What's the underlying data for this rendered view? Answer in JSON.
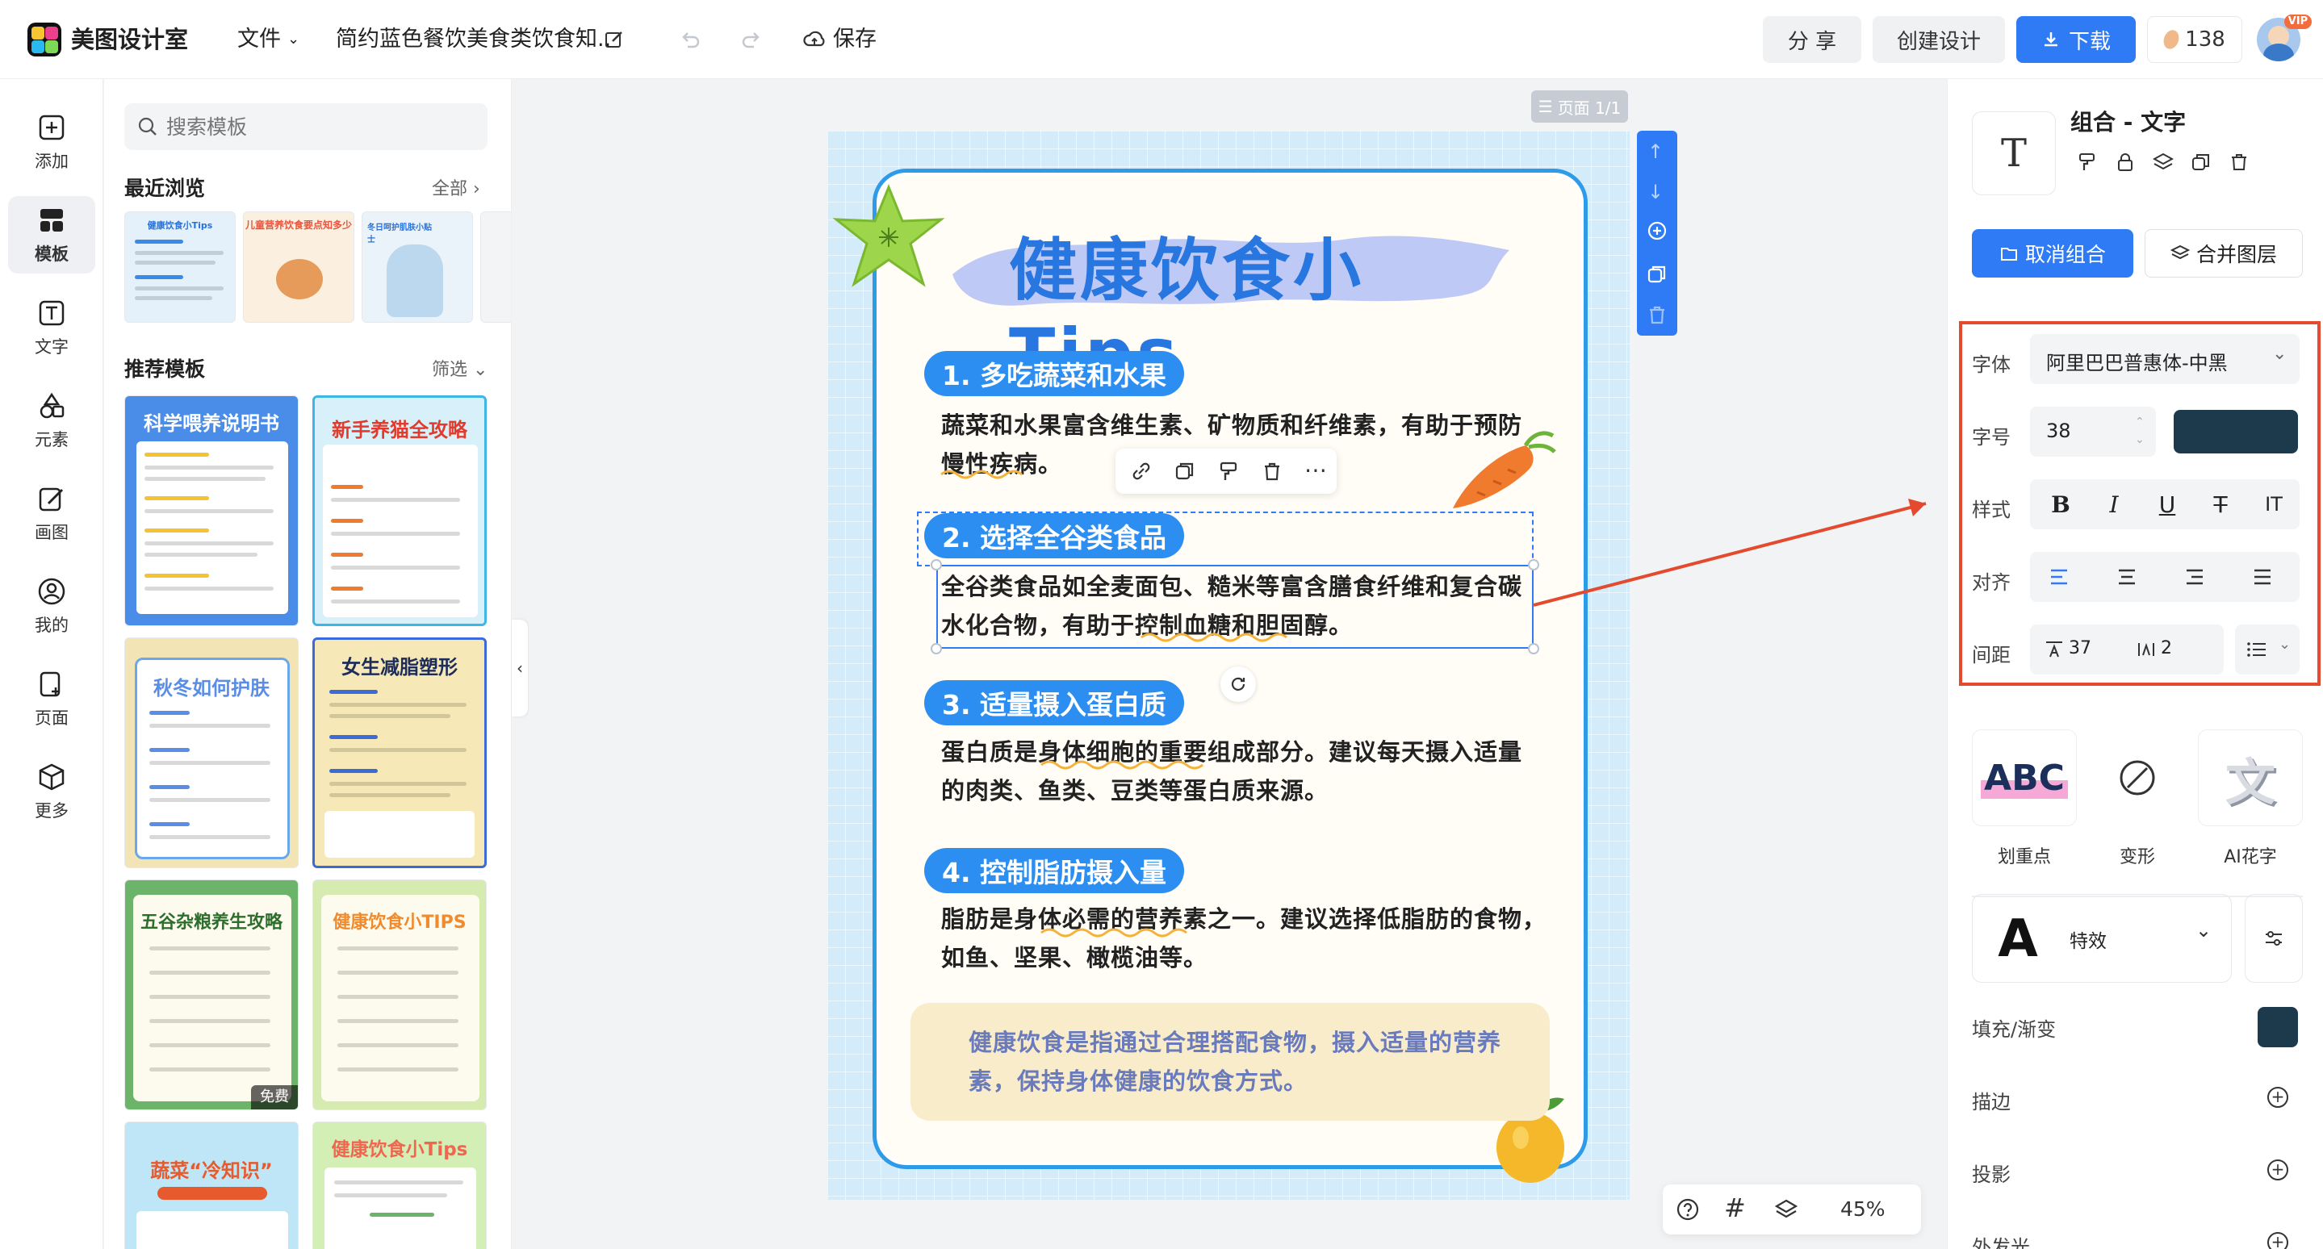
{
  "app": {
    "name": "美图设计室"
  },
  "topbar": {
    "file_menu": "文件",
    "doc_title": "简约蓝色餐饮美食类饮食知...",
    "save": "保存",
    "share": "分 享",
    "create": "创建设计",
    "download": "下载",
    "credits": "138",
    "vip": "VIP"
  },
  "rail": [
    {
      "label": "添加",
      "icon": "plus-square-icon"
    },
    {
      "label": "模板",
      "icon": "template-grid-icon",
      "active": true
    },
    {
      "label": "文字",
      "icon": "text-icon"
    },
    {
      "label": "元素",
      "icon": "shapes-icon"
    },
    {
      "label": "画图",
      "icon": "draw-icon"
    },
    {
      "label": "我的",
      "icon": "user-icon"
    },
    {
      "label": "页面",
      "icon": "page-add-icon"
    },
    {
      "label": "更多",
      "icon": "box-icon"
    }
  ],
  "templates": {
    "search_placeholder": "搜索模板",
    "recent_title": "最近浏览",
    "recent_more": "全部",
    "recommend_title": "推荐模板",
    "recommend_filter": "筛选",
    "cards": [
      {
        "title": "科学喂养说明书",
        "color": "#4a8de8",
        "title_color": "#fff"
      },
      {
        "title": "新手养猫全攻略",
        "color": "#d8f0fa",
        "title_color": "#e03b2d"
      },
      {
        "title": "秋冬如何护肤",
        "color": "#f2e4b4",
        "title_color": "#5a8ee6"
      },
      {
        "title": "女生减脂塑形",
        "color": "#f7e9b7",
        "title_color": "#1e2c5a"
      },
      {
        "title": "五谷杂粮养生攻略",
        "color": "#6db46b",
        "title_color": "#2d6e2c"
      },
      {
        "title": "健康饮食小TIPS",
        "color": "#d6ebb0",
        "title_color": "#f08b2d"
      },
      {
        "title": "蔬菜“冷知识”",
        "color": "#bfe6f7",
        "title_color": "#e65a2d"
      },
      {
        "title": "健康饮食小Tips",
        "color": "#d3efb6",
        "title_color": "#f0664f"
      }
    ],
    "free_badge": "免费",
    "recent_cards": [
      {
        "title": "健康饮食小Tips"
      },
      {
        "title": "儿童营养饮食要点知多少"
      },
      {
        "title": "冬日呵护肌肤小贴士"
      }
    ]
  },
  "canvas": {
    "page_chip": "页面 1/1",
    "zoom": "45%"
  },
  "poster": {
    "title": "健康饮食小Tips",
    "sections": [
      {
        "heading": "1. 多吃蔬菜和水果",
        "body": "蔬菜和水果富含维生素、矿物质和纤维素，有助于预防慢性疾病。"
      },
      {
        "heading": "2. 选择全谷类食品",
        "body": "全谷类食品如全麦面包、糙米等富含膳食纤维和复合碳水化合物，有助于控制血糖和胆固醇。"
      },
      {
        "heading": "3. 适量摄入蛋白质",
        "body": "蛋白质是身体细胞的重要组成部分。建议每天摄入适量的肉类、鱼类、豆类等蛋白质来源。"
      },
      {
        "heading": "4. 控制脂肪摄入量",
        "body": "脂肪是身体必需的营养素之一。建议选择低脂肪的食物，如鱼、坚果、橄榄油等。"
      }
    ],
    "summary": "健康饮食是指通过合理搭配食物，摄入适量的营养素，保持身体健康的饮食方式。"
  },
  "properties": {
    "header_title": "组合 - 文字",
    "ungroup": "取消组合",
    "merge": "合并图层",
    "font_label": "字体",
    "font_value": "阿里巴巴普惠体-中黑",
    "size_label": "字号",
    "size_value": "38",
    "text_color": "#1d3a4d",
    "style_label": "样式",
    "align_label": "对齐",
    "spacing_label": "间距",
    "letter_spacing": "37",
    "line_spacing": "2",
    "effects": [
      {
        "label": "划重点"
      },
      {
        "label": "变形"
      },
      {
        "label": "AI花字"
      }
    ],
    "special_effect": "特效",
    "fill_label": "填充/渐变",
    "fill_color": "#1d3a4d",
    "stroke_label": "描边",
    "shadow_label": "投影",
    "glow_label": "外发光"
  }
}
